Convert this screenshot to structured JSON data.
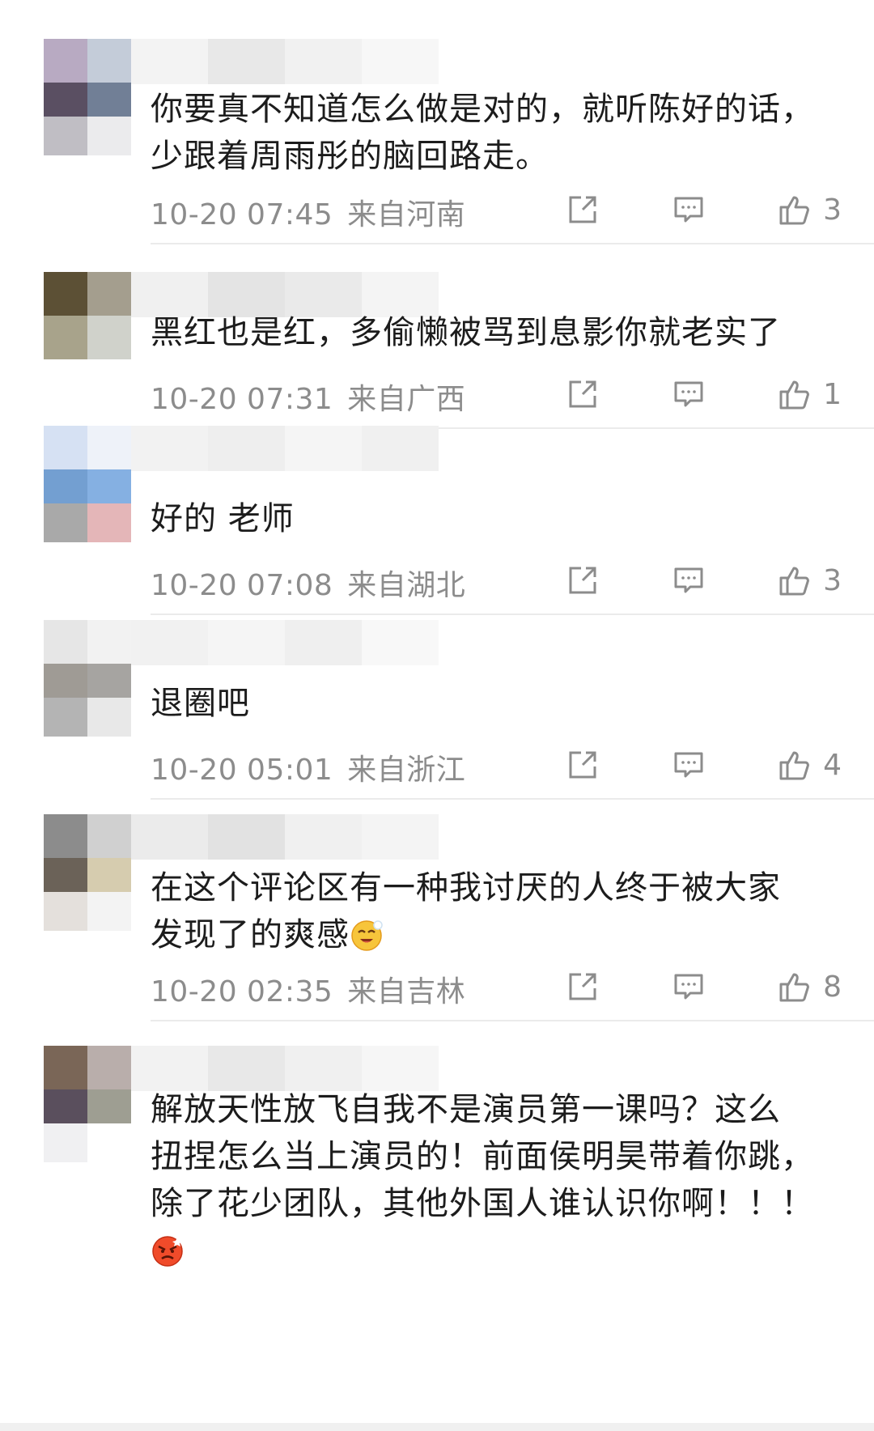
{
  "comments": [
    {
      "text_lines": [
        "你要真不知道怎么做是对的，就听陈好的话，",
        "少跟着周雨彤的脑回路走。"
      ],
      "time": "10-20 07:45",
      "location": "来自河南",
      "likes": "3",
      "avatar_colors": [
        "#b8aac2",
        "#c4ccd9",
        "#5a4f62",
        "#717f96",
        "#c0bec4",
        "#ebebed"
      ]
    },
    {
      "text_lines": [
        "黑红也是红，多偷懒被骂到息影你就老实了"
      ],
      "time": "10-20 07:31",
      "location": "来自广西",
      "likes": "1",
      "avatar_colors": [
        "#5c5035",
        "#a49e8e",
        "#a8a38b",
        "#d0d2cb"
      ]
    },
    {
      "text_lines": [
        "好的 老师"
      ],
      "time": "10-20 07:08",
      "location": "来自湖北",
      "likes": "3",
      "avatar_colors": [
        "#d6e1f3",
        "#eef2f9",
        "#739fd1",
        "#85b0e2",
        "#a9a9a9",
        "#e4b6b8"
      ]
    },
    {
      "text_lines": [
        "退圈吧"
      ],
      "time": "10-20 05:01",
      "location": "来自浙江",
      "likes": "4",
      "avatar_colors": [
        "#e6e6e6",
        "#f2f2f2",
        "#9f9b95",
        "#a6a4a1",
        "#b4b4b4",
        "#e8e8e8"
      ]
    },
    {
      "text_lines": [
        "在这个评论区有一种我讨厌的人终于被大家",
        "发现了的爽感"
      ],
      "time": "10-20 02:35",
      "location": "来自吉林",
      "likes": "8",
      "emoji": "smug-face-emoji",
      "avatar_colors": [
        "#8c8c8c",
        "#d0d0d0",
        "#6b6258",
        "#d6ccaf",
        "#e4e0dc",
        "#f3f3f3"
      ]
    },
    {
      "text_lines": [
        "解放天性放飞自我不是演员第一课吗？这么",
        "扭捏怎么当上演员的！前面侯明昊带着你跳，",
        "除了花少团队，其他外国人谁认识你啊！！！"
      ],
      "time": "",
      "location": "",
      "likes": "",
      "emoji": "angry-face-emoji",
      "avatar_colors": [
        "#7a6657",
        "#b9aeab",
        "#5a4f5d",
        "#9e9e92",
        "#f0f0f2",
        "#ffffff"
      ]
    }
  ],
  "icons": {
    "share": "share-icon",
    "reply": "comment-icon",
    "like": "thumbs-up-icon"
  },
  "colors": {
    "meta_gray": "#8c8c8c",
    "divider": "#ebebeb",
    "text": "#1c1c1c"
  }
}
